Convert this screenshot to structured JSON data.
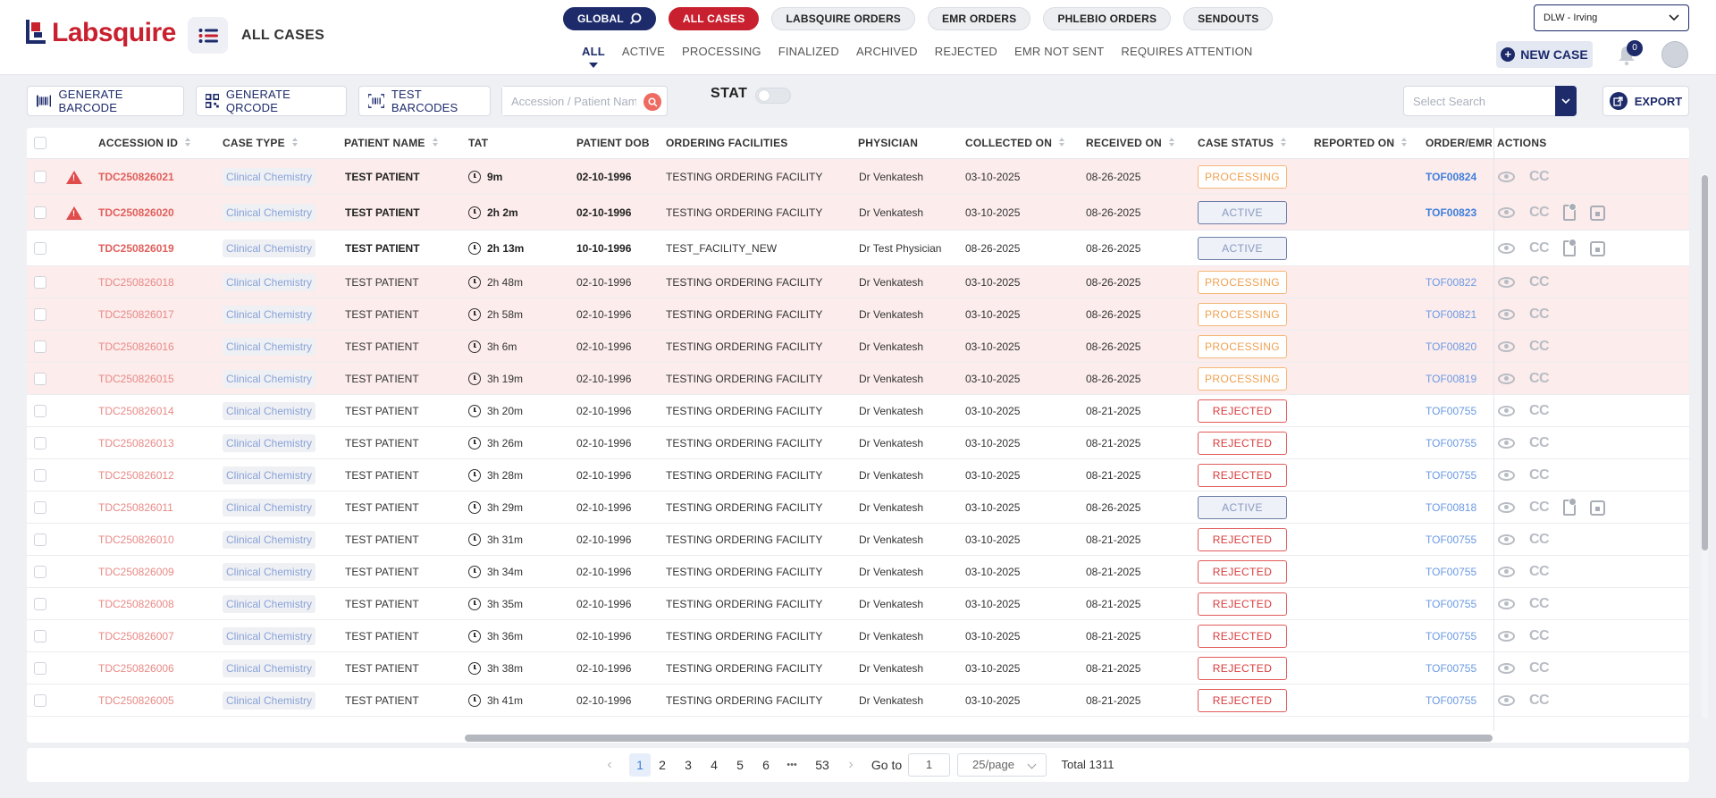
{
  "app": {
    "brand": "Labsquire",
    "page_title": "ALL CASES"
  },
  "header": {
    "pills": [
      "GLOBAL",
      "ALL CASES",
      "LABSQUIRE ORDERS",
      "EMR ORDERS",
      "PHLEBIO ORDERS",
      "SENDOUTS"
    ],
    "subtabs": [
      "ALL",
      "ACTIVE",
      "PROCESSING",
      "FINALIZED",
      "ARCHIVED",
      "REJECTED",
      "EMR NOT SENT",
      "REQUIRES ATTENTION"
    ],
    "active_subtab": "ALL",
    "location": "DLW - Irving",
    "new_case_label": "NEW CASE",
    "notification_count": "0"
  },
  "toolbar": {
    "generate_barcode": "GENERATE BARCODE",
    "generate_qrcode": "GENERATE QRCODE",
    "test_barcodes": "TEST BARCODES",
    "search_placeholder": "Accession / Patient Name",
    "stat_label": "STAT",
    "select_search_placeholder": "Select Search",
    "export_label": "EXPORT"
  },
  "table": {
    "columns": [
      "ACCESSION ID",
      "CASE TYPE",
      "PATIENT NAME",
      "TAT",
      "PATIENT DOB",
      "ORDERING FACILITIES",
      "PHYSICIAN",
      "COLLECTED ON",
      "RECEIVED ON",
      "CASE STATUS",
      "REPORTED ON",
      "ORDER/EMR/",
      "ACTIONS"
    ],
    "rows": [
      {
        "acc": "TDC250826021",
        "type": "Clinical Chemistry",
        "name": "TEST PATIENT",
        "tat": "9m",
        "dob": "02-10-1996",
        "facility": "TESTING ORDERING FACILITY",
        "physician": "Dr Venkatesh",
        "collected": "03-10-2025",
        "received": "08-26-2025",
        "status": "PROCESSING",
        "order": "TOF00824",
        "warn": true,
        "bold": true,
        "pink": true,
        "extra": false
      },
      {
        "acc": "TDC250826020",
        "type": "Clinical Chemistry",
        "name": "TEST PATIENT",
        "tat": "2h 2m",
        "dob": "02-10-1996",
        "facility": "TESTING ORDERING FACILITY",
        "physician": "Dr Venkatesh",
        "collected": "03-10-2025",
        "received": "08-26-2025",
        "status": "ACTIVE",
        "order": "TOF00823",
        "warn": true,
        "bold": true,
        "pink": true,
        "extra": true
      },
      {
        "acc": "TDC250826019",
        "type": "Clinical Chemistry",
        "name": "TEST PATIENT",
        "tat": "2h 13m",
        "dob": "10-10-1996",
        "facility": "TEST_FACILITY_NEW",
        "physician": "Dr Test Physician",
        "collected": "08-26-2025",
        "received": "08-26-2025",
        "status": "ACTIVE",
        "order": "",
        "warn": false,
        "bold": true,
        "pink": false,
        "extra": true
      },
      {
        "acc": "TDC250826018",
        "type": "Clinical Chemistry",
        "name": "TEST PATIENT",
        "tat": "2h 48m",
        "dob": "02-10-1996",
        "facility": "TESTING ORDERING FACILITY",
        "physician": "Dr Venkatesh",
        "collected": "03-10-2025",
        "received": "08-26-2025",
        "status": "PROCESSING",
        "order": "TOF00822",
        "warn": false,
        "bold": false,
        "pink": true,
        "extra": false
      },
      {
        "acc": "TDC250826017",
        "type": "Clinical Chemistry",
        "name": "TEST PATIENT",
        "tat": "2h 58m",
        "dob": "02-10-1996",
        "facility": "TESTING ORDERING FACILITY",
        "physician": "Dr Venkatesh",
        "collected": "03-10-2025",
        "received": "08-26-2025",
        "status": "PROCESSING",
        "order": "TOF00821",
        "warn": false,
        "bold": false,
        "pink": true,
        "extra": false
      },
      {
        "acc": "TDC250826016",
        "type": "Clinical Chemistry",
        "name": "TEST PATIENT",
        "tat": "3h 6m",
        "dob": "02-10-1996",
        "facility": "TESTING ORDERING FACILITY",
        "physician": "Dr Venkatesh",
        "collected": "03-10-2025",
        "received": "08-26-2025",
        "status": "PROCESSING",
        "order": "TOF00820",
        "warn": false,
        "bold": false,
        "pink": true,
        "extra": false
      },
      {
        "acc": "TDC250826015",
        "type": "Clinical Chemistry",
        "name": "TEST PATIENT",
        "tat": "3h 19m",
        "dob": "02-10-1996",
        "facility": "TESTING ORDERING FACILITY",
        "physician": "Dr Venkatesh",
        "collected": "03-10-2025",
        "received": "08-26-2025",
        "status": "PROCESSING",
        "order": "TOF00819",
        "warn": false,
        "bold": false,
        "pink": true,
        "extra": false
      },
      {
        "acc": "TDC250826014",
        "type": "Clinical Chemistry",
        "name": "TEST PATIENT",
        "tat": "3h 20m",
        "dob": "02-10-1996",
        "facility": "TESTING ORDERING FACILITY",
        "physician": "Dr Venkatesh",
        "collected": "03-10-2025",
        "received": "08-21-2025",
        "status": "REJECTED",
        "order": "TOF00755",
        "warn": false,
        "bold": false,
        "pink": false,
        "extra": false
      },
      {
        "acc": "TDC250826013",
        "type": "Clinical Chemistry",
        "name": "TEST PATIENT",
        "tat": "3h 26m",
        "dob": "02-10-1996",
        "facility": "TESTING ORDERING FACILITY",
        "physician": "Dr Venkatesh",
        "collected": "03-10-2025",
        "received": "08-21-2025",
        "status": "REJECTED",
        "order": "TOF00755",
        "warn": false,
        "bold": false,
        "pink": false,
        "extra": false
      },
      {
        "acc": "TDC250826012",
        "type": "Clinical Chemistry",
        "name": "TEST PATIENT",
        "tat": "3h 28m",
        "dob": "02-10-1996",
        "facility": "TESTING ORDERING FACILITY",
        "physician": "Dr Venkatesh",
        "collected": "03-10-2025",
        "received": "08-21-2025",
        "status": "REJECTED",
        "order": "TOF00755",
        "warn": false,
        "bold": false,
        "pink": false,
        "extra": false
      },
      {
        "acc": "TDC250826011",
        "type": "Clinical Chemistry",
        "name": "TEST PATIENT",
        "tat": "3h 29m",
        "dob": "02-10-1996",
        "facility": "TESTING ORDERING FACILITY",
        "physician": "Dr Venkatesh",
        "collected": "03-10-2025",
        "received": "08-26-2025",
        "status": "ACTIVE",
        "order": "TOF00818",
        "warn": false,
        "bold": false,
        "pink": false,
        "extra": true
      },
      {
        "acc": "TDC250826010",
        "type": "Clinical Chemistry",
        "name": "TEST PATIENT",
        "tat": "3h 31m",
        "dob": "02-10-1996",
        "facility": "TESTING ORDERING FACILITY",
        "physician": "Dr Venkatesh",
        "collected": "03-10-2025",
        "received": "08-21-2025",
        "status": "REJECTED",
        "order": "TOF00755",
        "warn": false,
        "bold": false,
        "pink": false,
        "extra": false
      },
      {
        "acc": "TDC250826009",
        "type": "Clinical Chemistry",
        "name": "TEST PATIENT",
        "tat": "3h 34m",
        "dob": "02-10-1996",
        "facility": "TESTING ORDERING FACILITY",
        "physician": "Dr Venkatesh",
        "collected": "03-10-2025",
        "received": "08-21-2025",
        "status": "REJECTED",
        "order": "TOF00755",
        "warn": false,
        "bold": false,
        "pink": false,
        "extra": false
      },
      {
        "acc": "TDC250826008",
        "type": "Clinical Chemistry",
        "name": "TEST PATIENT",
        "tat": "3h 35m",
        "dob": "02-10-1996",
        "facility": "TESTING ORDERING FACILITY",
        "physician": "Dr Venkatesh",
        "collected": "03-10-2025",
        "received": "08-21-2025",
        "status": "REJECTED",
        "order": "TOF00755",
        "warn": false,
        "bold": false,
        "pink": false,
        "extra": false
      },
      {
        "acc": "TDC250826007",
        "type": "Clinical Chemistry",
        "name": "TEST PATIENT",
        "tat": "3h 36m",
        "dob": "02-10-1996",
        "facility": "TESTING ORDERING FACILITY",
        "physician": "Dr Venkatesh",
        "collected": "03-10-2025",
        "received": "08-21-2025",
        "status": "REJECTED",
        "order": "TOF00755",
        "warn": false,
        "bold": false,
        "pink": false,
        "extra": false
      },
      {
        "acc": "TDC250826006",
        "type": "Clinical Chemistry",
        "name": "TEST PATIENT",
        "tat": "3h 38m",
        "dob": "02-10-1996",
        "facility": "TESTING ORDERING FACILITY",
        "physician": "Dr Venkatesh",
        "collected": "03-10-2025",
        "received": "08-21-2025",
        "status": "REJECTED",
        "order": "TOF00755",
        "warn": false,
        "bold": false,
        "pink": false,
        "extra": false
      },
      {
        "acc": "TDC250826005",
        "type": "Clinical Chemistry",
        "name": "TEST PATIENT",
        "tat": "3h 41m",
        "dob": "02-10-1996",
        "facility": "TESTING ORDERING FACILITY",
        "physician": "Dr Venkatesh",
        "collected": "03-10-2025",
        "received": "08-21-2025",
        "status": "REJECTED",
        "order": "TOF00755",
        "warn": false,
        "bold": false,
        "pink": false,
        "extra": false
      }
    ]
  },
  "pagination": {
    "pages": [
      "1",
      "2",
      "3",
      "4",
      "5",
      "6",
      "•••",
      "53"
    ],
    "current": "1",
    "goto_label": "Go to",
    "goto_value": "1",
    "per_page": "25/page",
    "total": "Total 1311"
  }
}
